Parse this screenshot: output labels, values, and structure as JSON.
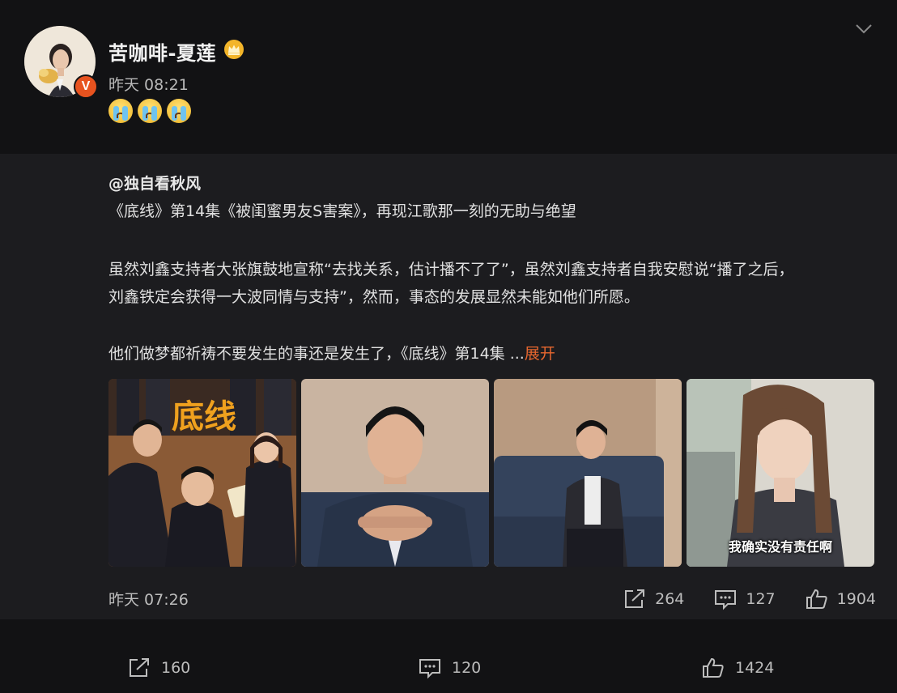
{
  "post": {
    "username": "苦咖啡-夏莲",
    "time": "昨天 08:21",
    "verified_badge": "V",
    "crown_icon": "crown-icon",
    "emojis": [
      "crying-emoji",
      "crying-emoji",
      "crying-emoji"
    ]
  },
  "repost": {
    "author": "@独自看秋风",
    "lines": [
      "《底线》第14集《被闺蜜男友S害案》，再现江歌那一刻的无助与绝望",
      "虽然刘鑫支持者大张旗鼓地宣称“去找关系，估计播不了了”，虽然刘鑫支持者自我安慰说“播了之后，",
      "刘鑫铁定会获得一大波同情与支持”，然而，事态的发展显然未能如他们所愿。",
      "他们做梦都祈祷不要发生的事还是发生了，《底线》第14集 ..."
    ],
    "expand_label": "展开",
    "images": [
      {
        "alt": "底线 poster",
        "poster_title": "底线"
      },
      {
        "alt": "man in suit portrait"
      },
      {
        "alt": "man sitting on sofa"
      },
      {
        "alt": "woman still frame",
        "caption": "我确实没有责任啊"
      }
    ],
    "time": "昨天 07:26",
    "share_count": "264",
    "comment_count": "127",
    "like_count": "1904"
  },
  "footer": {
    "share_count": "160",
    "comment_count": "120",
    "like_count": "1424"
  },
  "colors": {
    "background": "#121214",
    "repost_background": "#1c1c1f",
    "accent": "#e8672f",
    "badge": "#e8531f"
  }
}
